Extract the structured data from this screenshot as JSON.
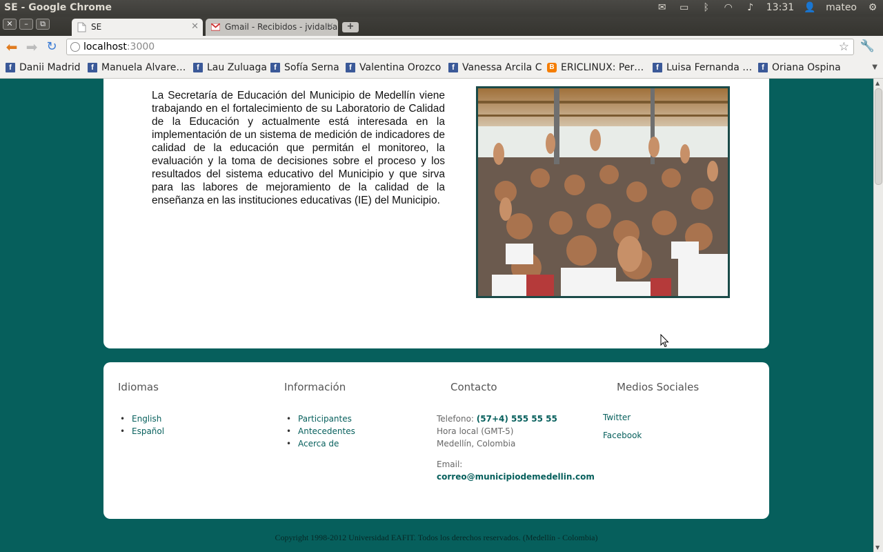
{
  "os": {
    "window_title": "SE - Google Chrome",
    "time": "13:31",
    "user": "mateo"
  },
  "window_controls": {
    "close": "✕",
    "minimize": "–",
    "restore": "⧉"
  },
  "tabs": [
    {
      "label": "SE",
      "active": true
    },
    {
      "label": "Gmail - Recibidos - jvidalba",
      "active": false
    }
  ],
  "toolbar": {
    "url_host": "localhost",
    "url_port": ":3000"
  },
  "bookmarks": [
    {
      "label": "Danii Madrid",
      "icon": "facebook-icon"
    },
    {
      "label": "Manuela Alvare…",
      "icon": "facebook-icon"
    },
    {
      "label": "Lau Zuluaga",
      "icon": "facebook-icon"
    },
    {
      "label": "Sofía Serna",
      "icon": "facebook-icon"
    },
    {
      "label": "Valentina Orozco",
      "icon": "facebook-icon"
    },
    {
      "label": "Vanessa Arcila C",
      "icon": "facebook-icon"
    },
    {
      "label": "ERICLINUX: Per…",
      "icon": "blogger-icon"
    },
    {
      "label": "Luisa Fernanda …",
      "icon": "facebook-icon"
    },
    {
      "label": "Oriana Ospina",
      "icon": "facebook-icon"
    }
  ],
  "content": {
    "intro_text": "La Secretaría de Educación del Municipio de Medellín viene trabajando en el fortalecimiento de su Laboratorio de Calidad de la Educación y actualmente está interesada en la implementación de un sistema de medición de indicadores de calidad de la educación que permitán el monitoreo, la evaluación y la toma de decisiones sobre el proceso y los resultados del sistema educativo del Municipio y que sirva para las labores de mejoramiento de la calidad de la enseñanza en las instituciones educativas (IE) del Municipio."
  },
  "footer": {
    "idiomas": {
      "title": "Idiomas",
      "links": [
        "English",
        "Español"
      ]
    },
    "informacion": {
      "title": "Información",
      "links": [
        "Participantes",
        "Antecedentes",
        "Acerca de"
      ]
    },
    "contacto": {
      "title": "Contacto",
      "phone_label": "Telefono: ",
      "phone": "(57+4) 555 55 55",
      "hours": "Hora local (GMT-5)",
      "city": "Medellín, Colombia",
      "email_label": "Email:",
      "email": "correo@municipiodemedellin.com"
    },
    "social": {
      "title": "Medios Sociales",
      "links": [
        "Twitter",
        "Facebook"
      ]
    },
    "copyright": "Copyright 1998-2012 Universidad EAFIT. Todos los derechos reservados. (Medellín - Colombia)"
  },
  "colors": {
    "page_bg": "#065f5c",
    "link": "#065f5c",
    "card": "#ffffff"
  }
}
